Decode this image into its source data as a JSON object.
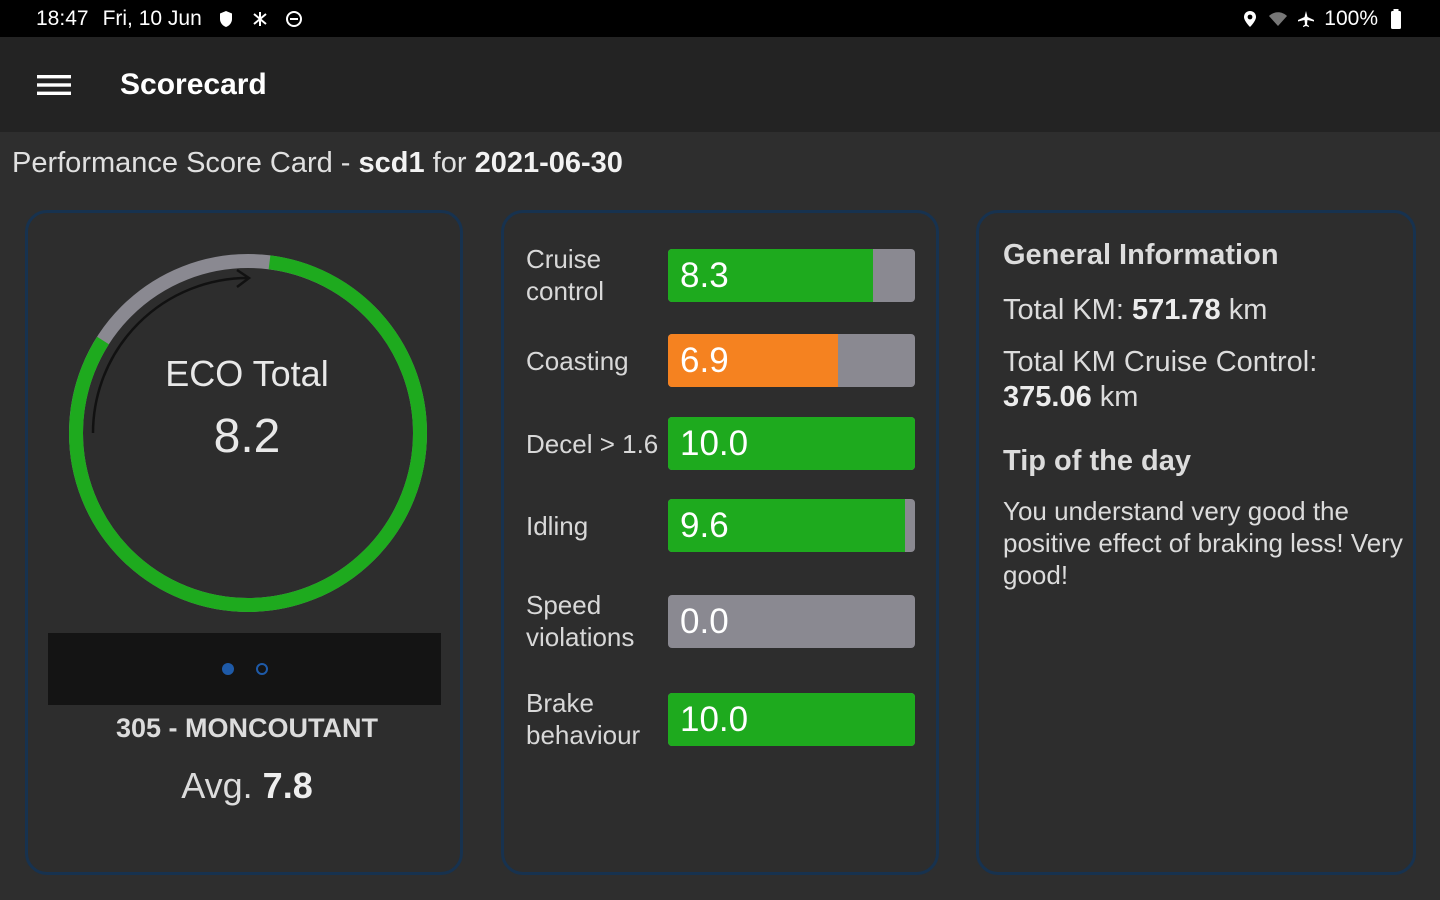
{
  "status_bar": {
    "time": "18:47",
    "date": "Fri, 10 Jun",
    "battery": "100%",
    "icons_left": [
      "shield-icon",
      "notification-icon",
      "do-not-disturb-icon"
    ],
    "icons_right": [
      "location-icon",
      "wifi-icon",
      "airplane-icon",
      "battery-icon"
    ]
  },
  "app_bar": {
    "menu_icon": "hamburger-menu-icon",
    "title": "Scorecard"
  },
  "heading": {
    "prefix": "Performance Score Card - ",
    "driver": "scd1",
    "for_text": " for ",
    "date": "2021-06-30"
  },
  "eco": {
    "title": "ECO Total",
    "value": "8.2",
    "score": 8.2,
    "max": 10,
    "site": "305 - MONCOUTANT",
    "avg_label": "Avg. ",
    "avg_value": "7.8",
    "pages": 2,
    "active_page": 1
  },
  "metrics": [
    {
      "label": "Cruise control",
      "value": "8.3",
      "score": 8.3,
      "color": "#1eaa1e"
    },
    {
      "label": "Coasting",
      "value": "6.9",
      "score": 6.9,
      "color": "#f58220"
    },
    {
      "label": "Decel > 1.6",
      "value": "10.0",
      "score": 10.0,
      "color": "#1eaa1e"
    },
    {
      "label": "Idling",
      "value": "9.6",
      "score": 9.6,
      "color": "#1eaa1e"
    },
    {
      "label": "Speed violations",
      "value": "0.0",
      "score": 0.0,
      "color": "#1eaa1e"
    },
    {
      "label": "Brake behaviour",
      "value": "10.0",
      "score": 10.0,
      "color": "#1eaa1e"
    }
  ],
  "general_info": {
    "title": "General Information",
    "total_km_label": "Total KM: ",
    "total_km_value": "571.78",
    "total_km_unit": " km",
    "cruise_km_label": "Total KM Cruise Control:",
    "cruise_km_value": "375.06",
    "cruise_km_unit": " km",
    "tip_title": "Tip of the day",
    "tip_text": "You understand very good the positive effect of braking less! Very good!"
  },
  "colors": {
    "gauge_fill": "#1eaa1e",
    "gauge_track": "#8a8991",
    "card_border": "#17324f"
  }
}
